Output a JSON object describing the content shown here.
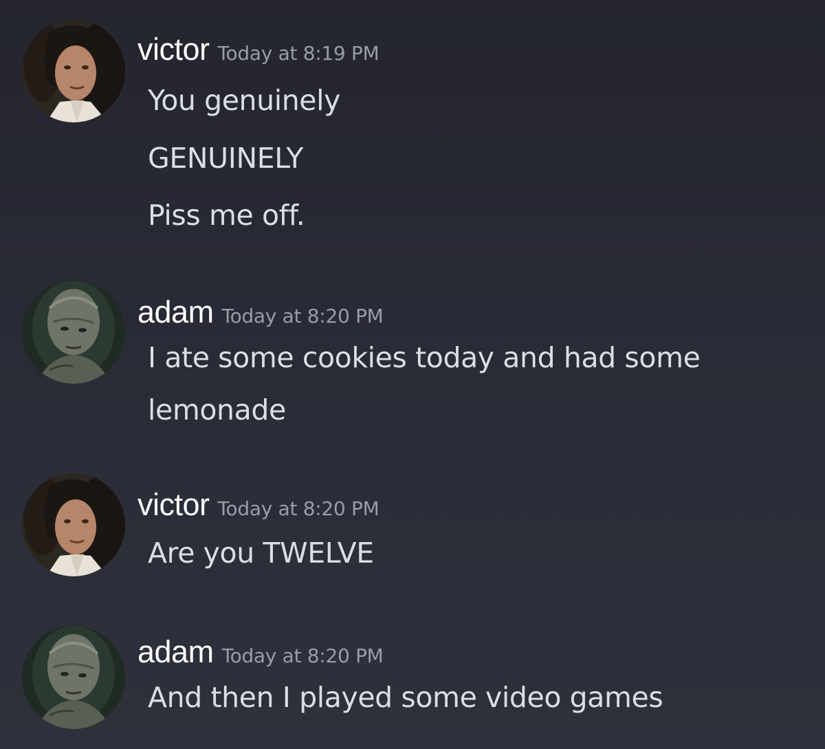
{
  "messages": [
    {
      "author": "victor",
      "timestamp": "Today at 8:19 PM",
      "avatar_icon": "user-avatar-icon",
      "lines": [
        "You genuinely",
        "GENUINELY",
        "Piss me off."
      ]
    },
    {
      "author": "adam",
      "timestamp": "Today at 8:20 PM",
      "avatar_icon": "user-avatar-icon",
      "lines": [
        "I ate some cookies today and had some",
        "lemonade"
      ]
    },
    {
      "author": "victor",
      "timestamp": "Today at 8:20 PM",
      "avatar_icon": "user-avatar-icon",
      "lines": [
        "Are you TWELVE"
      ]
    },
    {
      "author": "adam",
      "timestamp": "Today at 8:20 PM",
      "avatar_icon": "user-avatar-icon",
      "lines": [
        "And then I played some video games"
      ]
    }
  ],
  "colors": {
    "background": "#262833",
    "username": "#ffffff",
    "timestamp": "#9a9ca8",
    "message_text": "#dcdee6"
  }
}
